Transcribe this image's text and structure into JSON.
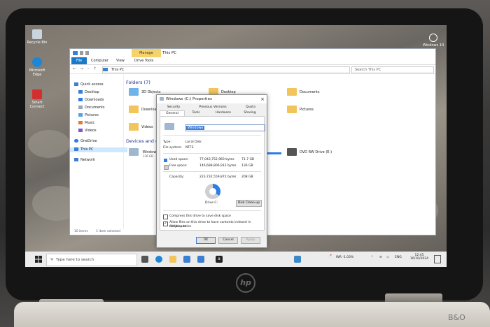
{
  "desktop": {
    "icons": [
      {
        "label": "Recycle Bin"
      },
      {
        "label": "Microsoft Edge"
      },
      {
        "label": "Smart Connect"
      }
    ],
    "top_right_icon_label": "Windows 10"
  },
  "explorer": {
    "title": "This PC",
    "manage_tab": "Manage",
    "ribbon_tabs": [
      "File",
      "Computer",
      "View",
      "Drive Tools"
    ],
    "address": "This PC",
    "search_placeholder": "Search This PC",
    "nav": {
      "quick_access": "Quick access",
      "items": [
        "Desktop",
        "Downloads",
        "Documents",
        "Pictures",
        "Music",
        "Videos"
      ],
      "onedrive": "OneDrive",
      "this_pc": "This PC",
      "network": "Network"
    },
    "folders_header": "Folders (7)",
    "folders": [
      "3D Objects",
      "Desktop",
      "Documents",
      "Downloads",
      "Pictures",
      "Videos"
    ],
    "devices_header": "Devices and d",
    "devices": {
      "windows_drive_label": "Window",
      "windows_drive_free": "136 GB",
      "dvd_label": "DVD RW Drive (E:)"
    },
    "status": {
      "items": "10 items",
      "selected": "1 item selected"
    }
  },
  "dialog": {
    "title": "Windows (C:) Properties",
    "tabs_row1": [
      "Security",
      "Previous Versions",
      "Quota"
    ],
    "tabs_row2": [
      "General",
      "Tools",
      "Hardware",
      "Sharing"
    ],
    "drive_name": "Windows",
    "type_label": "Type:",
    "type_value": "Local Disk",
    "fs_label": "File system:",
    "fs_value": "NTFS",
    "used_label": "Used space:",
    "used_bytes": "77,043,752,960 bytes",
    "used_gb": "71.7 GB",
    "free_label": "Free space:",
    "free_bytes": "146,688,806,912 bytes",
    "free_gb": "136 GB",
    "capacity_label": "Capacity:",
    "capacity_bytes": "223,732,559,872 bytes",
    "capacity_gb": "208 GB",
    "drive_caption": "Drive C:",
    "cleanup_label": "Disk Clean-up",
    "used_fraction": 0.344,
    "compress_label": "Compress this drive to save disk space",
    "index_label_1": "Allow files on this drive to have contents indexed in addition to",
    "index_label_2": "file properties",
    "ok": "OK",
    "cancel": "Cancel",
    "apply": "Apply",
    "colors": {
      "used": "#2b7de9",
      "free": "#cfcfcf"
    }
  },
  "taskbar": {
    "search_placeholder": "Type here to search",
    "weather": "INR -1.03%",
    "lang": "ENG",
    "time": "12:45",
    "date": "16/10/2024"
  },
  "laptop": {
    "logo": "hp",
    "deck_logo": "B&O"
  }
}
